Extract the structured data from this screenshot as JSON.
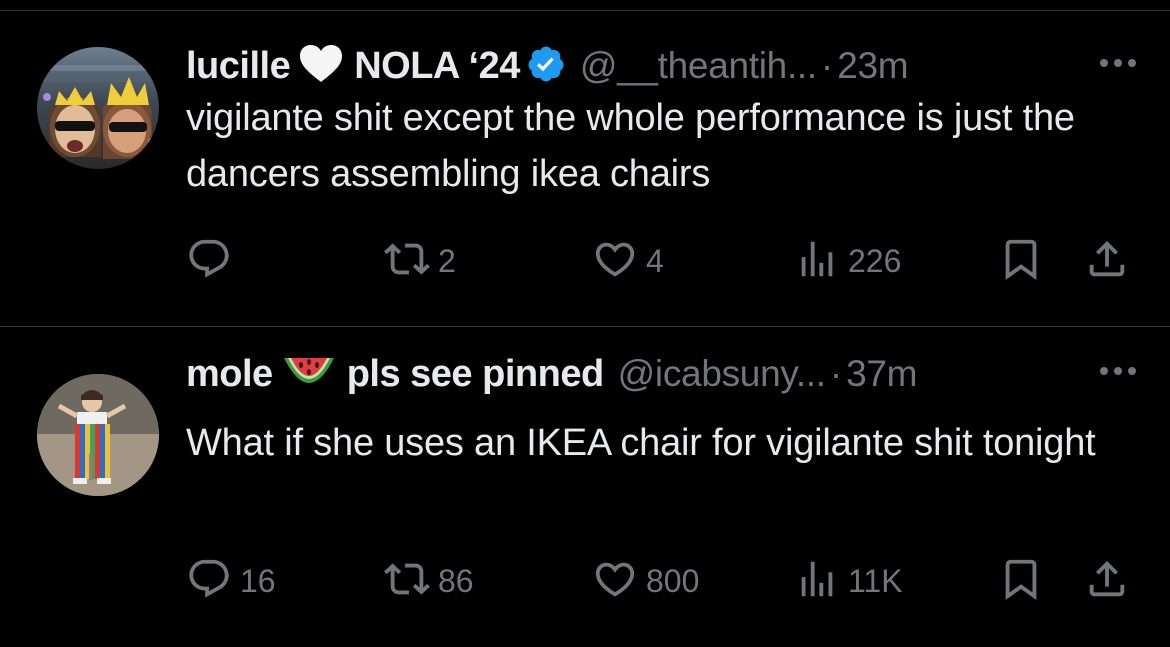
{
  "tweets": [
    {
      "display_name": "lucille",
      "name_suffix": "NOLA ‘24",
      "verified": true,
      "handle": "@__theantih...",
      "separator": "·",
      "time": "23m",
      "text": "vigilante shit except the whole performance is just the dancers assembling ikea chairs",
      "reply_count": "",
      "retweet_count": "2",
      "like_count": "4",
      "view_count": "226"
    },
    {
      "display_name": "mole",
      "name_suffix": "pls see pinned",
      "verified": false,
      "handle": "@icabsuny...",
      "separator": "·",
      "time": "37m",
      "text": "What if she uses an IKEA chair for vigilante shit tonight",
      "reply_count": "16",
      "retweet_count": "86",
      "like_count": "800",
      "view_count": "11K"
    }
  ],
  "icons": {
    "tweet1_name_emoji": "white-heart-icon",
    "tweet2_name_emoji": "watermelon-icon",
    "verified": "verified-badge-icon",
    "more": "more-options-icon",
    "reply": "reply-icon",
    "retweet": "retweet-icon",
    "like": "like-icon",
    "views": "views-icon",
    "bookmark": "bookmark-icon",
    "share": "share-icon"
  },
  "colors": {
    "background": "#000000",
    "primary_text": "#e7e9ea",
    "secondary_text": "#71767b",
    "divider": "#2f3336",
    "verified_blue": "#1d9bf0"
  }
}
